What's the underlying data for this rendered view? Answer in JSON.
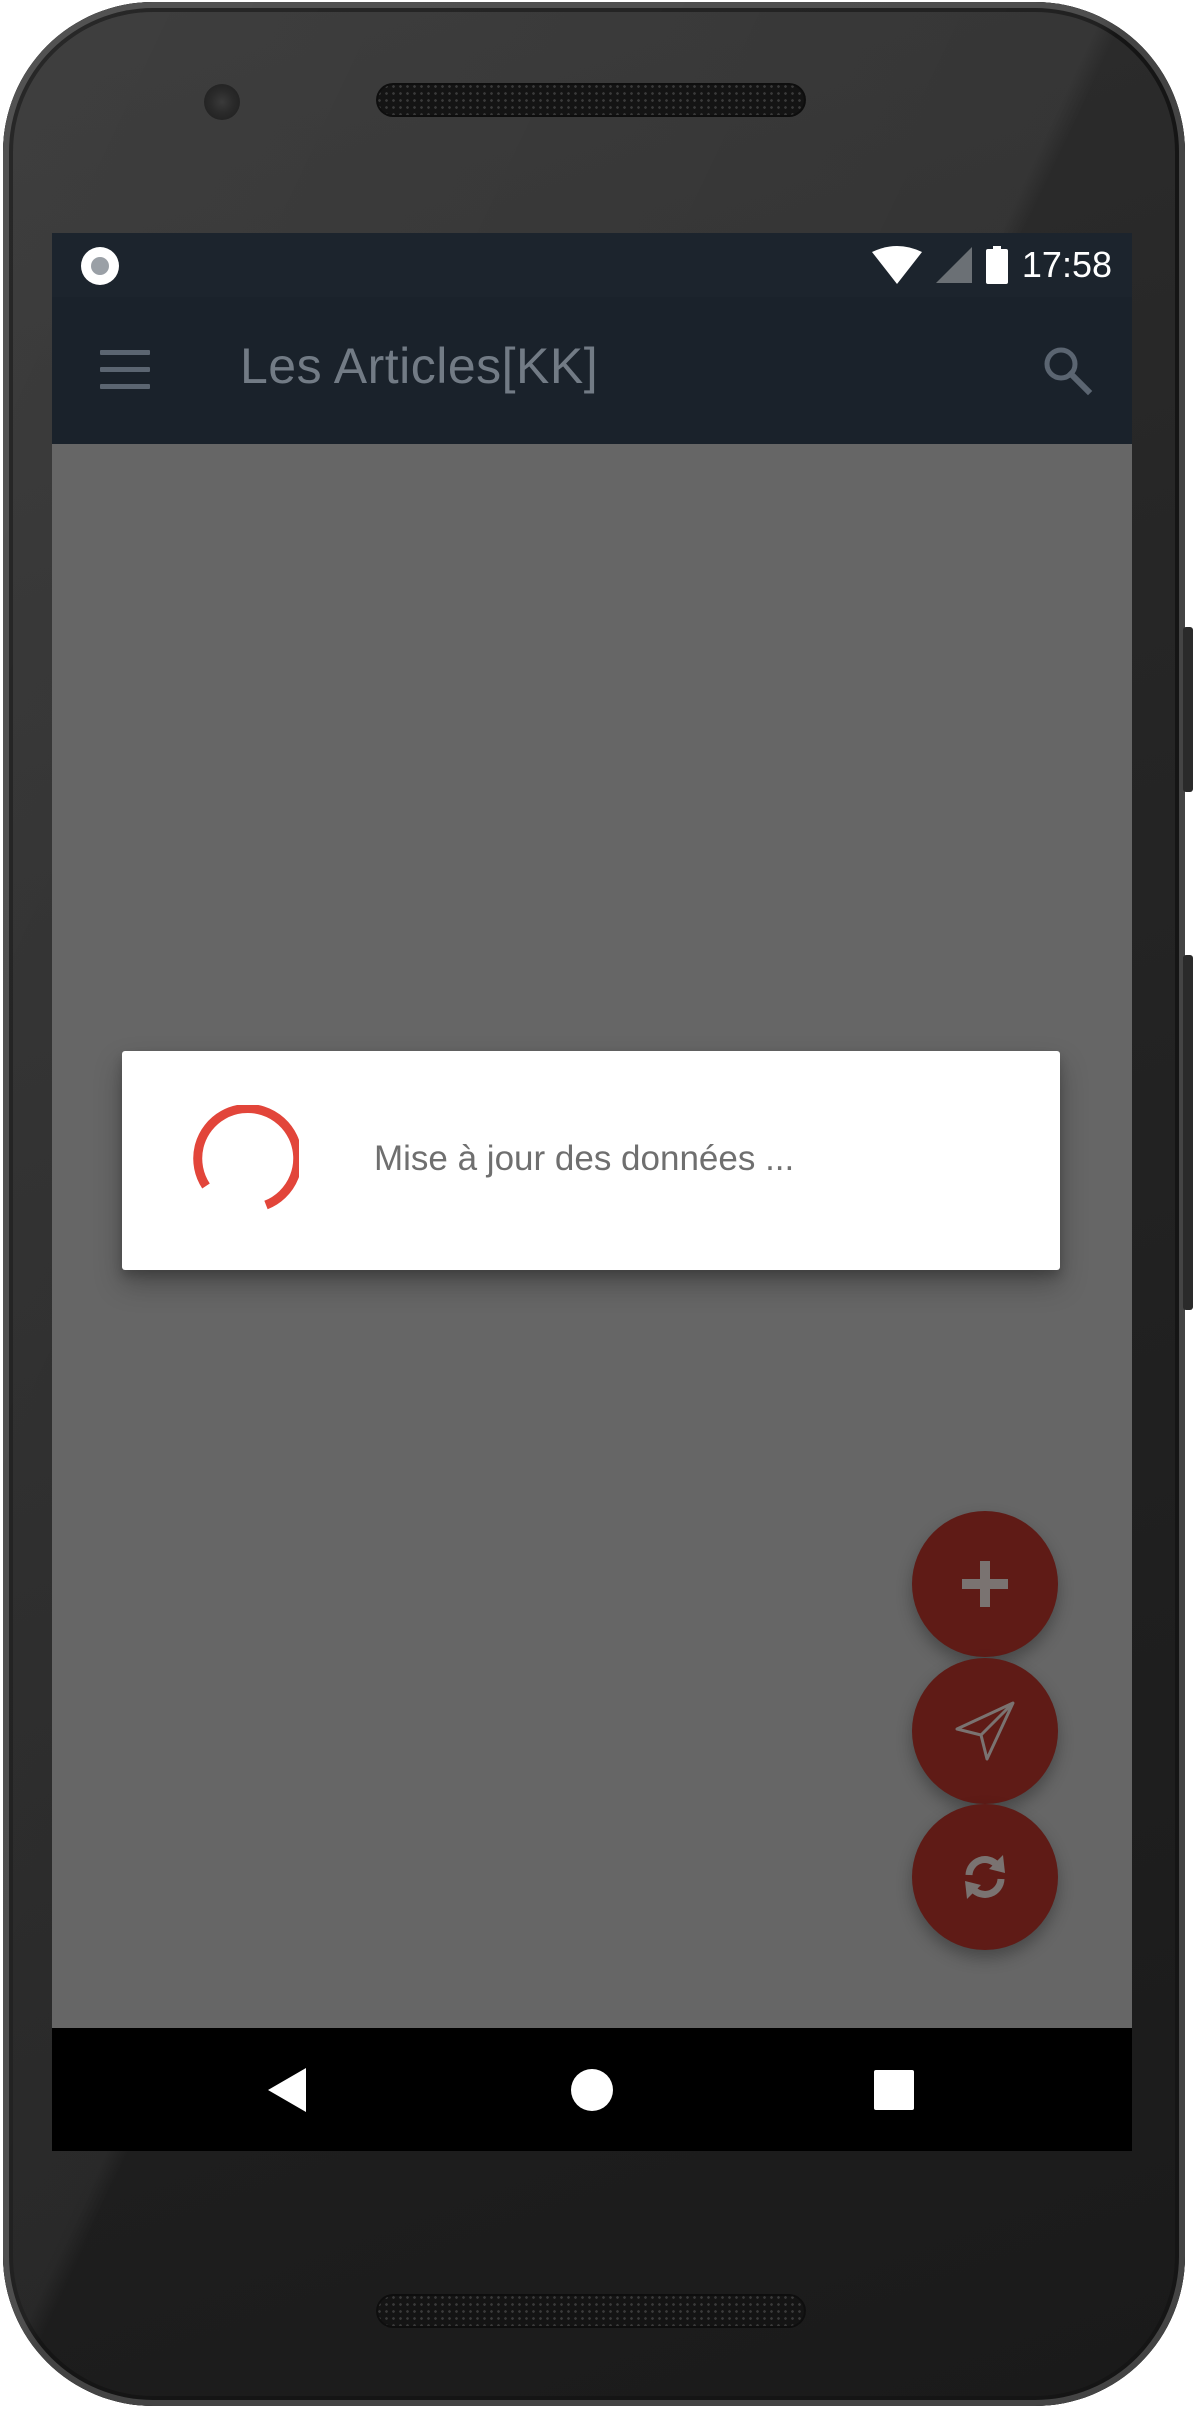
{
  "status_bar": {
    "time": "17:58",
    "icons": [
      "notification-dot-icon",
      "wifi-icon",
      "cell-signal-icon",
      "battery-icon"
    ]
  },
  "app_bar": {
    "title": "Les Articles[KK]",
    "icons": [
      "menu-icon",
      "search-icon"
    ]
  },
  "dialog": {
    "message": "Mise à jour des données ...",
    "icon": "loading-spinner-icon"
  },
  "fabs": [
    {
      "icon": "plus-icon"
    },
    {
      "icon": "send-icon"
    },
    {
      "icon": "refresh-icon"
    }
  ],
  "nav_bar": {
    "icons": [
      "back-icon",
      "home-icon",
      "recents-icon"
    ]
  },
  "colors": {
    "app_bar": "#1a222b",
    "scrim": "#666666",
    "fab": "#5f1b16",
    "spinner": "#e2453a",
    "dialog_text": "#6f6f6f"
  }
}
